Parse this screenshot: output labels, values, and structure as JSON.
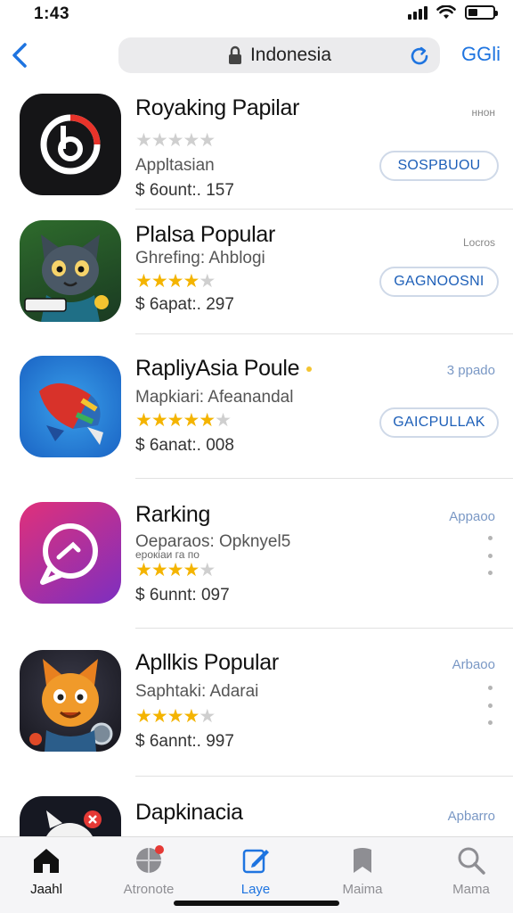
{
  "status_bar": {
    "time": "1:43"
  },
  "nav": {
    "search_text": "Indonesia",
    "action_label": "GGli"
  },
  "apps": [
    {
      "title": "Royaking Papilar",
      "subtitle": "Appltasian",
      "rating": 0,
      "price": "$ 6ount:. 157",
      "side_label": "ннон",
      "button_label": "SOSPBUOU"
    },
    {
      "title": "Plalsa Popular",
      "subtitle": "Ghrefing: Ahblogi",
      "rating": 4.5,
      "price": "$ 6apat:. 297",
      "side_label": "Locros",
      "button_label": "GAGNOOSNI"
    },
    {
      "title": "RapliyAsia Poule",
      "subtitle": "Mapkiari: Afeanandal",
      "rating": 5,
      "price": "$ 6anat:. 008",
      "side_label": "3 ppado",
      "button_label": "GAICPULLAK"
    },
    {
      "title": "Rarking",
      "subtitle": "Oeparaos: Opknyel5",
      "subtitle2": "ерокіаи га по",
      "rating": 4.5,
      "price": "$ 6unnt: 097",
      "side_label": "Appaoo"
    },
    {
      "title": "Apllkis Popular",
      "subtitle": "Saphtaki: Adarai",
      "rating": 4.5,
      "price": "$ 6annt:. 997",
      "side_label": "Arbaoo"
    },
    {
      "title": "Dapkinacia",
      "side_label": "Apbarro"
    }
  ],
  "tabs": [
    {
      "label": "Jaahl",
      "icon": "home-icon"
    },
    {
      "label": "Atronote",
      "icon": "globe-icon",
      "badge": true
    },
    {
      "label": "Laye",
      "icon": "edit-icon",
      "active": true
    },
    {
      "label": "Maima",
      "icon": "bookmark-icon"
    },
    {
      "label": "Mama",
      "icon": "search-icon"
    }
  ],
  "colors": {
    "accent": "#1e74e0",
    "star": "#f4b400",
    "tab_inactive": "#8e8e93"
  }
}
